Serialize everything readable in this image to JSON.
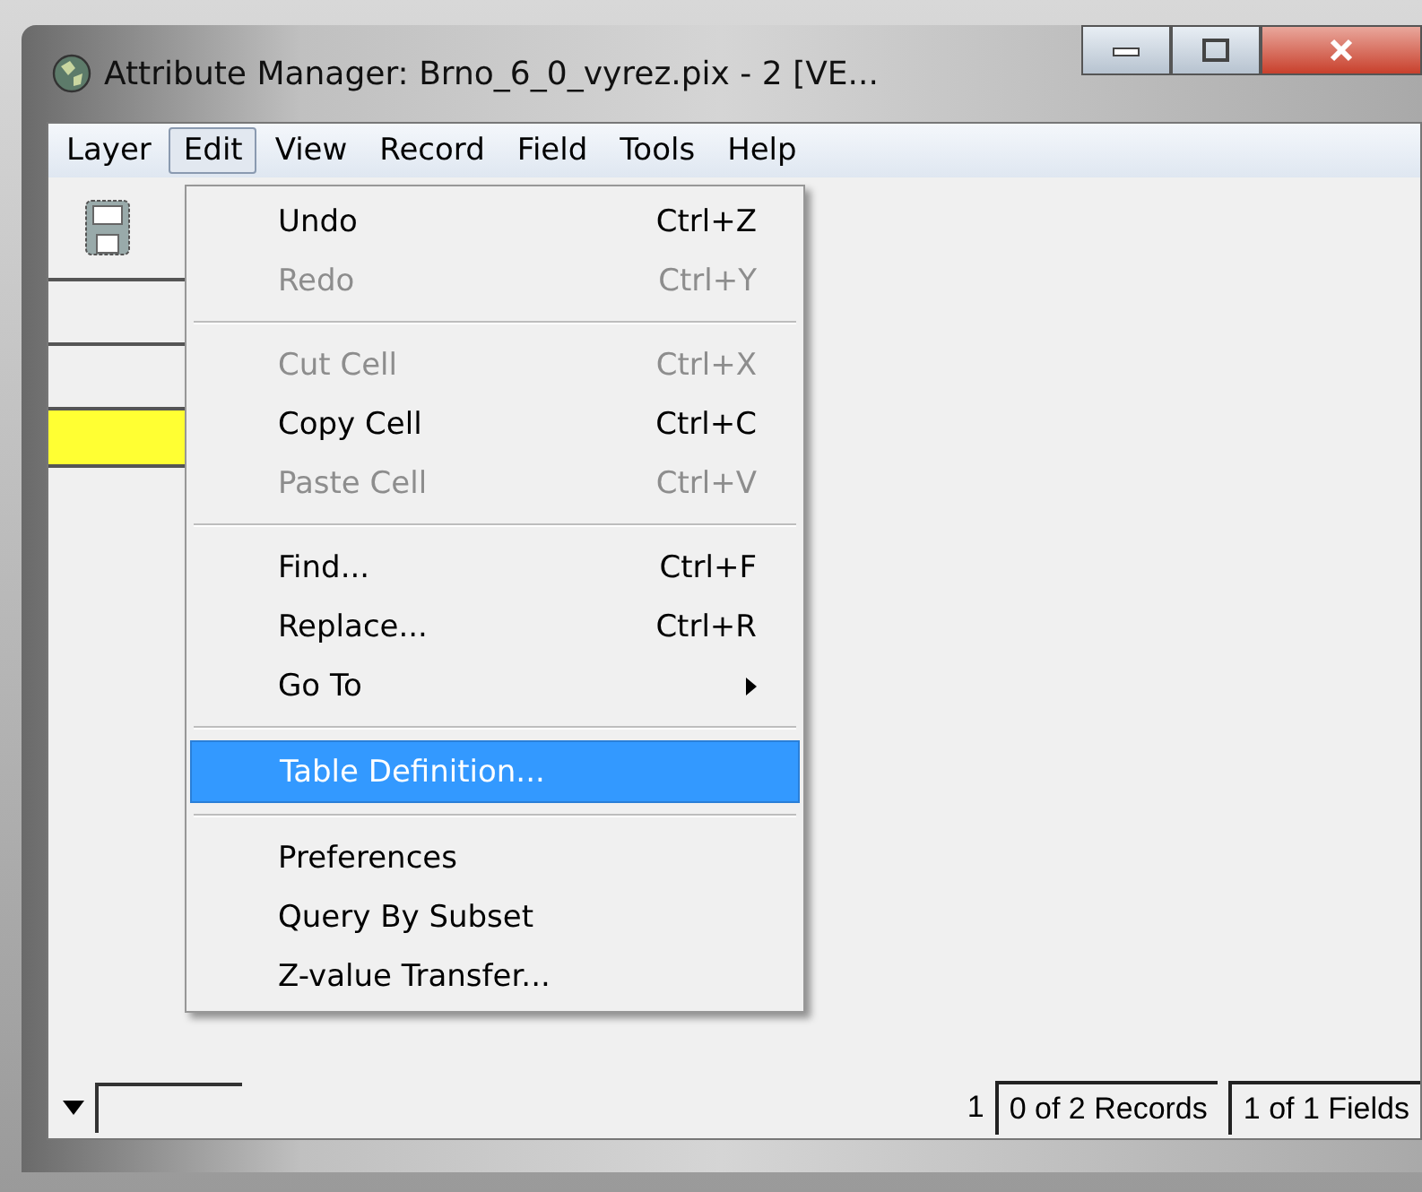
{
  "window": {
    "title": "Attribute Manager: Brno_6_0_vyrez.pix - 2 [VE..."
  },
  "menubar": [
    {
      "label": "Layer",
      "selected": false
    },
    {
      "label": "Edit",
      "selected": true
    },
    {
      "label": "View",
      "selected": false
    },
    {
      "label": "Record",
      "selected": false
    },
    {
      "label": "Field",
      "selected": false
    },
    {
      "label": "Tools",
      "selected": false
    },
    {
      "label": "Help",
      "selected": false
    }
  ],
  "edit_menu": [
    {
      "kind": "item",
      "label": "Undo",
      "shortcut": "Ctrl+Z",
      "disabled": false,
      "selected": false
    },
    {
      "kind": "item",
      "label": "Redo",
      "shortcut": "Ctrl+Y",
      "disabled": true,
      "selected": false
    },
    {
      "kind": "separator"
    },
    {
      "kind": "item",
      "label": "Cut Cell",
      "shortcut": "Ctrl+X",
      "disabled": true,
      "selected": false
    },
    {
      "kind": "item",
      "label": "Copy Cell",
      "shortcut": "Ctrl+C",
      "disabled": false,
      "selected": false
    },
    {
      "kind": "item",
      "label": "Paste Cell",
      "shortcut": "Ctrl+V",
      "disabled": true,
      "selected": false
    },
    {
      "kind": "separator"
    },
    {
      "kind": "item",
      "label": "Find...",
      "shortcut": "Ctrl+F",
      "disabled": false,
      "selected": false
    },
    {
      "kind": "item",
      "label": "Replace...",
      "shortcut": "Ctrl+R",
      "disabled": false,
      "selected": false
    },
    {
      "kind": "submenu",
      "label": "Go To",
      "disabled": false,
      "selected": false
    },
    {
      "kind": "separator"
    },
    {
      "kind": "item",
      "label": "Table Definition...",
      "disabled": false,
      "selected": true
    },
    {
      "kind": "separator"
    },
    {
      "kind": "item",
      "label": "Preferences",
      "disabled": false,
      "selected": false
    },
    {
      "kind": "item",
      "label": "Query By Subset",
      "disabled": false,
      "selected": false
    },
    {
      "kind": "item",
      "label": "Z-value Transfer...",
      "disabled": false,
      "selected": false
    }
  ],
  "status_bar": {
    "record_number": "1",
    "records": "0 of 2 Records",
    "fields": "1 of 1 Fields"
  }
}
